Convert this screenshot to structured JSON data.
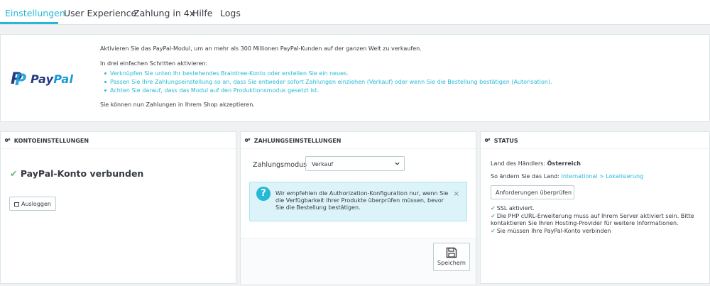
{
  "tabs": [
    {
      "label": "Einstellungen",
      "active": true
    },
    {
      "label": "User Experience",
      "active": false
    },
    {
      "label": "Zahlung in 4x",
      "active": false
    },
    {
      "label": "Hilfe",
      "active": false
    },
    {
      "label": "Logs",
      "active": false
    }
  ],
  "colors": {
    "accent": "#25b9d7",
    "success": "#70b580",
    "paypal_dark": "#253b80",
    "paypal_light": "#179bd7"
  },
  "intro": {
    "logo_text_a": "Pay",
    "logo_text_b": "Pal",
    "line1": "Aktivieren Sie das PayPal-Modul, um an mehr als 300 Millionen PayPal-Kunden auf der ganzen Welt zu verkaufen.",
    "line2": "In drei einfachen Schritten aktivieren:",
    "steps": [
      "Verknüpfen Sie unten Ihr bestehendes Braintree-Konto oder erstellen Sie ein neues.",
      "Passen Sie Ihre Zahlungseinstellung so an, dass Sie entweder sofort Zahlungen einziehen (Verkauf) oder wenn Sie die Bestellung bestätigen (Autorisation).",
      "Achten Sie darauf, dass das Modul auf den Produktionsmodus gesetzt ist."
    ],
    "line3": "Sie können nun Zahlungen in Ihrem Shop akzeptieren."
  },
  "account": {
    "title": "KONTOEINSTELLUNGEN",
    "status": "PayPal-Konto verbunden",
    "logout_label": "Ausloggen"
  },
  "payment": {
    "title": "ZAHLUNGSEINSTELLUNGEN",
    "mode_label": "Zahlungsmodus",
    "mode_value": "Verkauf",
    "alert": "Wir empfehlen die Authorization-Konfiguration nur, wenn Sie die Verfügbarkeit Ihrer Produkte überprüfen müssen, bevor Sie die Bestellung bestätigen.",
    "save_label": "Speichern"
  },
  "status": {
    "title": "STATUS",
    "country_label": "Land des Händlers:",
    "country_value": "Österreich",
    "change_label": "So ändern Sie das Land:",
    "change_link": "International > Lokalisierung",
    "check_label": "Anforderungen überprüfen",
    "checks": [
      "SSL aktiviert.",
      "Die PHP cURL-Erweiterung muss auf Ihrem Server aktiviert sein. Bitte kontaktieren Sie Ihren Hosting-Provider für weitere Informationen.",
      "Sie müssen Ihre PayPal-Konto verbinden"
    ]
  }
}
